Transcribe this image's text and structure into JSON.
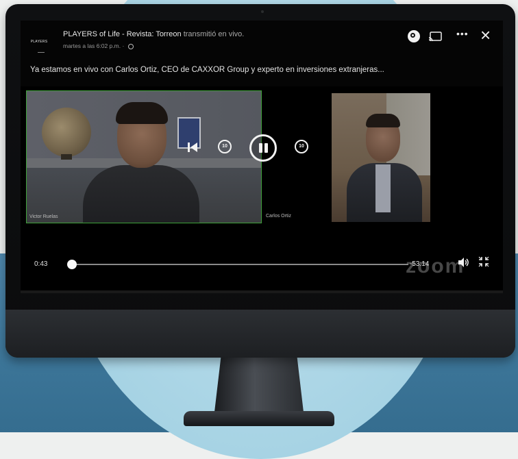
{
  "post": {
    "page_logo": "PLAYERS",
    "author": "PLAYERS of Life - Revista: Torreon",
    "verb": "transmitió en vivo.",
    "timestamp": "martes a las 6:02 p.m. ·",
    "text": "Ya estamos en vivo con Carlos Ortiz, CEO de CAXXOR Group y experto en inversiones extranjeras..."
  },
  "video": {
    "participants": [
      {
        "name": "Victor Ruelas"
      },
      {
        "name": "Carlos Ortiz"
      }
    ],
    "controls": {
      "rewind_label": "10",
      "forward_label": "10"
    },
    "current_time": "0:43",
    "remaining_time": "-53:14",
    "progress_fraction": 0.013,
    "watermark": "zoom"
  },
  "icons": {
    "messenger": "messenger-icon",
    "cast": "cast-icon",
    "more": "more-icon",
    "close": "close-icon",
    "volume": "volume-icon",
    "fullscreen": "fullscreen-icon"
  },
  "colors": {
    "active_speaker_border": "#3fa23a",
    "background_circle": "#acd6e6",
    "background_bottom": "#3c7598"
  }
}
